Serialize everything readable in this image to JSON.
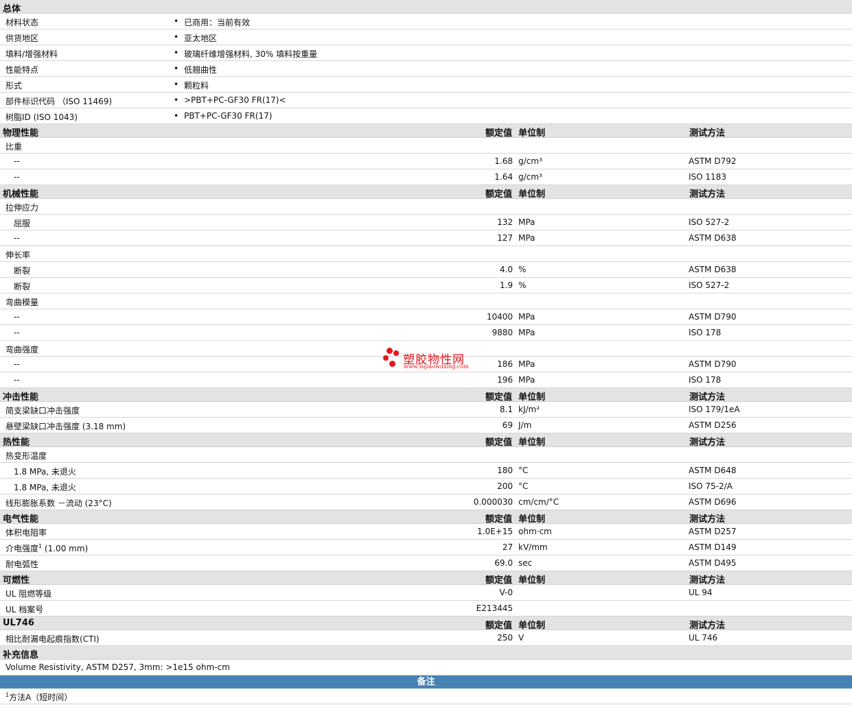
{
  "general": {
    "title": "总体",
    "rows": [
      {
        "label": "材料状态",
        "value": "已商用：当前有效"
      },
      {
        "label": "供货地区",
        "value": "亚太地区"
      },
      {
        "label": "填料/增强材料",
        "value": "玻璃纤维增强材料, 30% 填料按重量"
      },
      {
        "label": "性能特点",
        "value": "低翘曲性"
      },
      {
        "label": "形式",
        "value": "颗粒料"
      },
      {
        "label": "部件标识代码 （ISO 11469)",
        "value": ">PBT+PC-GF30 FR(17)<"
      },
      {
        "label": "树脂ID (ISO 1043)",
        "value": "PBT+PC-GF30 FR(17)"
      }
    ],
    "bullet": "•"
  },
  "col_headers": {
    "nominal": "额定值",
    "unit": "单位制",
    "test": "测试方法"
  },
  "physical": {
    "title": "物理性能",
    "rows": [
      {
        "label": "比重"
      },
      {
        "sub": "--",
        "nominal": "1.68",
        "unit": "g/cm³",
        "test": "ASTM D792"
      },
      {
        "sub": "--",
        "nominal": "1.64",
        "unit": "g/cm³",
        "test": "ISO 1183"
      }
    ]
  },
  "mechanical": {
    "title": "机械性能",
    "rows": [
      {
        "label": "拉伸应力"
      },
      {
        "sub": "屈服",
        "nominal": "132",
        "unit": "MPa",
        "test": "ISO 527-2"
      },
      {
        "sub": "--",
        "nominal": "127",
        "unit": "MPa",
        "test": "ASTM D638"
      },
      {
        "label": "伸长率"
      },
      {
        "sub": "断裂",
        "nominal": "4.0",
        "unit": "%",
        "test": "ASTM D638"
      },
      {
        "sub": "断裂",
        "nominal": "1.9",
        "unit": "%",
        "test": "ISO 527-2"
      },
      {
        "label": "弯曲模量"
      },
      {
        "sub": "--",
        "nominal": "10400",
        "unit": "MPa",
        "test": "ASTM D790"
      },
      {
        "sub": "--",
        "nominal": "9880",
        "unit": "MPa",
        "test": "ISO 178"
      },
      {
        "label": "弯曲强度"
      },
      {
        "sub": "--",
        "nominal": "186",
        "unit": "MPa",
        "test": "ASTM D790"
      },
      {
        "sub": "--",
        "nominal": "196",
        "unit": "MPa",
        "test": "ISO 178"
      }
    ]
  },
  "impact": {
    "title": "冲击性能",
    "rows": [
      {
        "label": "简支梁缺口冲击强度",
        "nominal": "8.1",
        "unit": "kJ/m²",
        "test": "ISO 179/1eA"
      },
      {
        "label": "悬壁梁缺口冲击强度 (3.18 mm)",
        "nominal": "69",
        "unit": "J/m",
        "test": "ASTM D256"
      }
    ]
  },
  "thermal": {
    "title": "热性能",
    "rows": [
      {
        "label": "热变形温度"
      },
      {
        "sub": "1.8 MPa, 未退火",
        "nominal": "180",
        "unit": "°C",
        "test": "ASTM D648"
      },
      {
        "sub": "1.8 MPa, 未退火",
        "nominal": "200",
        "unit": "°C",
        "test": "ISO 75-2/A"
      },
      {
        "label": "线形膨胀系数 －流动 (23°C)",
        "nominal": "0.000030",
        "unit": "cm/cm/°C",
        "test": "ASTM D696"
      }
    ]
  },
  "electrical": {
    "title": "电气性能",
    "rows": [
      {
        "label": "体积电阻率",
        "nominal": "1.0E+15",
        "unit": "ohm·cm",
        "test": "ASTM D257"
      },
      {
        "label": "介电强度",
        "sup": "1",
        "label_suffix": " (1.00 mm)",
        "nominal": "27",
        "unit": "kV/mm",
        "test": "ASTM D149"
      },
      {
        "label": "耐电弧性",
        "nominal": "69.0",
        "unit": "sec",
        "test": "ASTM D495"
      }
    ]
  },
  "flammability": {
    "title": "可燃性",
    "rows": [
      {
        "label": "UL 阻燃等级",
        "nominal": "V-0",
        "test": "UL 94"
      },
      {
        "label": "UL 档案号",
        "nominal": "E213445"
      }
    ]
  },
  "ul746": {
    "title": "UL746",
    "rows": [
      {
        "label": "相比耐漏电起痕指数(CTI)",
        "nominal": "250",
        "unit": "V",
        "test": "UL 746"
      }
    ]
  },
  "supplement": {
    "title": "补充信息",
    "text": "Volume Resistivity, ASTM D257, 3mm: >1e15 ohm-cm"
  },
  "notes": {
    "title": "备注",
    "sup": "1",
    "text": "方法A（短时间）"
  },
  "watermark": {
    "name": "塑胶物性网",
    "url": "www.sujiaowuxing.com",
    "color": "#e8141c"
  }
}
